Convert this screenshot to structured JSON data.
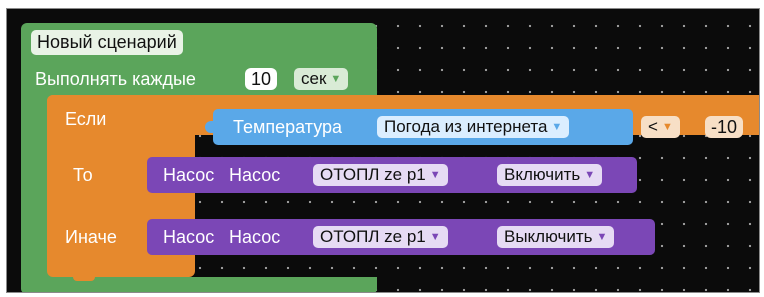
{
  "scenario": {
    "title": "Новый сценарий",
    "repeat_label": "Выполнять каждые",
    "interval_value": "10",
    "interval_unit": "сек"
  },
  "if_block": {
    "if_label": "Если",
    "then_label": "То",
    "else_label": "Иначе"
  },
  "condition": {
    "sensor_label": "Температура",
    "source": "Погода из интернета",
    "operator": "<",
    "value": "-10"
  },
  "then_action": {
    "type_label": "Насос",
    "device_label": "Насос",
    "device": "ОТОПЛ ze p1",
    "action": "Включить"
  },
  "else_action": {
    "type_label": "Насос",
    "device_label": "Насос",
    "device": "ОТОПЛ ze p1",
    "action": "Выключить"
  },
  "colors": {
    "scenario": "#5ba55b",
    "if_block": "#e6892d",
    "sensor": "#5aa8e8",
    "pump": "#7b47b6",
    "canvas": "#0b0b0b"
  },
  "icons": {
    "dropdown_arrow": "▼"
  }
}
